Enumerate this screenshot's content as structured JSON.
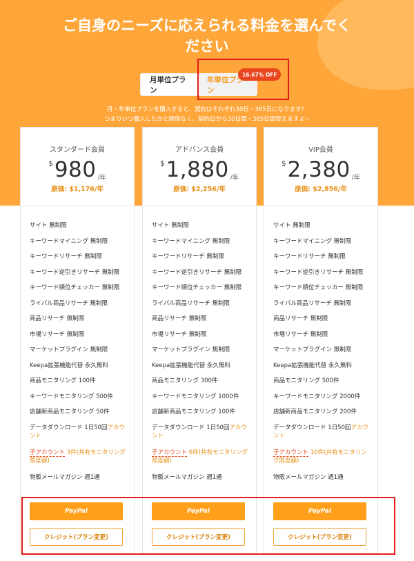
{
  "hero": {
    "title_line1": "ご自身のニーズに応えられる料金を選んでく",
    "title_line2": "ださい"
  },
  "toggle": {
    "monthly_label": "月単位プラン",
    "yearly_label": "年単位プラン",
    "off_badge": "16.67% OFF"
  },
  "notice": {
    "line1": "月・年単位プランを購入すると、契約はそれぞれ30日・365日になります！",
    "line2": "つまりいつ購入したかと関係なく、契約日から30日間・365日間使えますよ~"
  },
  "plans": [
    {
      "name": "スタンダード会員",
      "currency": "$",
      "price": "980",
      "per": "/年",
      "original": "原価: $1,176/年",
      "features": [
        "サイト 無制限",
        "キーワードマイニング 無制限",
        "キーワードリサーチ 無制限",
        "キーワード逆引きリサーチ 無制限",
        "キーワード順位チェッカー 無制限",
        "ライバル商品リサーチ 無制限",
        "商品リサーチ 無制限",
        "市場リサーチ 無制限",
        "マーケットプラグイン 無制限",
        "Keepa拡張機能代替 永久無料",
        "商品モニタリング 100件",
        "キーワードモニタリング 500件",
        "店舗新商品モニタリング 50件"
      ],
      "download_prefix": "データダウンロード 1日50回",
      "download_suffix": "アカウント",
      "sub_label": "子アカウント",
      "sub_value": "3件(共有モニタリング限度額)",
      "mail": "物販メールマガジン 週1通",
      "paypal_label": "PayPal",
      "credit_label": "クレジット(プラン変更)"
    },
    {
      "name": "アドバンス会員",
      "currency": "$",
      "price": "1,880",
      "per": "/年",
      "original": "原価: $2,256/年",
      "features": [
        "サイト 無制限",
        "キーワードマイニング 無制限",
        "キーワードリサーチ 無制限",
        "キーワード逆引きリサーチ 無制限",
        "キーワード順位チェッカー 無制限",
        "ライバル商品リサーチ 無制限",
        "商品リサーチ 無制限",
        "市場リサーチ 無制限",
        "マーケットプラグイン 無制限",
        "Keepa拡張機能代替 永久無料",
        "商品モニタリング 300件",
        "キーワードモニタリング 1000件",
        "店舗新商品モニタリング 100件"
      ],
      "download_prefix": "データダウンロード 1日50回",
      "download_suffix": "アカウント",
      "sub_label": "子アカウント",
      "sub_value": "6件(共有モニタリング限度額)",
      "mail": "物販メールマガジン 週1通",
      "paypal_label": "PayPal",
      "credit_label": "クレジット(プラン変更)"
    },
    {
      "name": "VIP会員",
      "currency": "$",
      "price": "2,380",
      "per": "/年",
      "original": "原価: $2,856/年",
      "features": [
        "サイト 無制限",
        "キーワードマイニング 無制限",
        "キーワードリサーチ 無制限",
        "キーワード逆引きリサーチ 無制限",
        "キーワード順位チェッカー 無制限",
        "ライバル商品リサーチ 無制限",
        "商品リサーチ 無制限",
        "市場リサーチ 無制限",
        "マーケットプラグイン 無制限",
        "Keepa拡張機能代替 永久無料",
        "商品モニタリング 500件",
        "キーワードモニタリング 2000件",
        "店舗新商品モニタリング 200件"
      ],
      "download_prefix": "データダウンロード 1日50回",
      "download_suffix": "アカウント",
      "sub_label": "子アカウント",
      "sub_value": "10件(共有モニタリング限度額)",
      "mail": "物販メールマガジン 週1通",
      "paypal_label": "PayPal",
      "credit_label": "クレジット(プラン変更)"
    }
  ],
  "colors": {
    "hero_bg": "#ffa63a",
    "accent": "#ff9f1a",
    "badge": "#e8461e",
    "highlight_box": "#e51a1a"
  }
}
